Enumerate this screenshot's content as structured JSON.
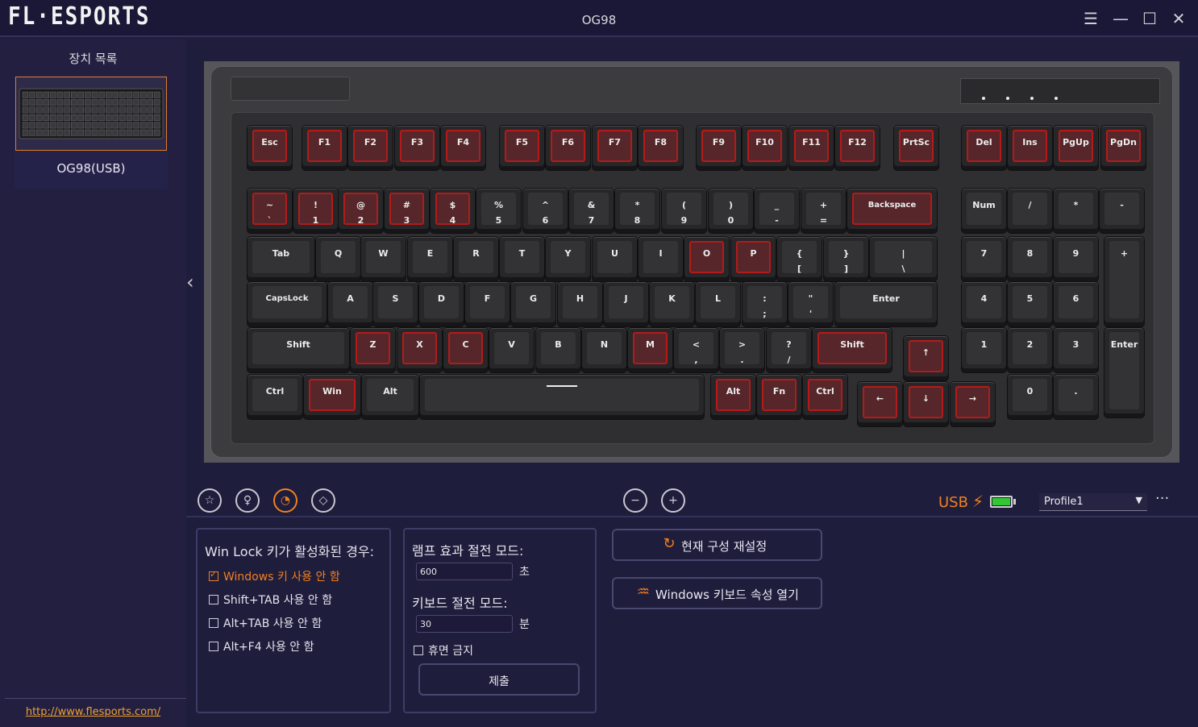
{
  "app": {
    "logo": "FL·ESPORTS",
    "window_title": "OG98"
  },
  "window_controls": {
    "menu_icon": "hamburger-icon",
    "minimize_icon": "minimize-icon",
    "maximize_icon": "maximize-icon",
    "close_icon": "close-icon"
  },
  "sidebar": {
    "title": "장치 목록",
    "device": {
      "name": "OG98(USB)"
    },
    "link": "http://www.flesports.com/"
  },
  "keyboard": {
    "highlight_color": "#b51a1a",
    "keys": [
      {
        "label": "Esc",
        "hl": true
      },
      {
        "label": "F1",
        "hl": true
      },
      {
        "label": "F2",
        "hl": true
      },
      {
        "label": "F3",
        "hl": true
      },
      {
        "label": "F4",
        "hl": true
      },
      {
        "label": "F5",
        "hl": true
      },
      {
        "label": "F6",
        "hl": true
      },
      {
        "label": "F7",
        "hl": true
      },
      {
        "label": "F8",
        "hl": true
      },
      {
        "label": "F9",
        "hl": true
      },
      {
        "label": "F10",
        "hl": true
      },
      {
        "label": "F11",
        "hl": true
      },
      {
        "label": "F12",
        "hl": true
      },
      {
        "label": "PrtSc",
        "hl": true
      },
      {
        "label": "Del",
        "hl": true
      },
      {
        "label": "Ins",
        "hl": true
      },
      {
        "label": "PgUp",
        "hl": true
      },
      {
        "label": "PgDn",
        "hl": true
      },
      {
        "label": "~\n`",
        "hl": true
      },
      {
        "label": "!\n1",
        "hl": true
      },
      {
        "label": "@\n2",
        "hl": true
      },
      {
        "label": "#\n3",
        "hl": true
      },
      {
        "label": "$\n4",
        "hl": true
      },
      {
        "label": "%\n5",
        "hl": false
      },
      {
        "label": "^\n6",
        "hl": false
      },
      {
        "label": "&\n7",
        "hl": false
      },
      {
        "label": "*\n8",
        "hl": false
      },
      {
        "label": "(\n9",
        "hl": false
      },
      {
        "label": ")\n0",
        "hl": false
      },
      {
        "label": "_\n-",
        "hl": false
      },
      {
        "label": "+\n=",
        "hl": false
      },
      {
        "label": "Backspace",
        "hl": true
      },
      {
        "label": "Num",
        "hl": false
      },
      {
        "label": "/",
        "hl": false
      },
      {
        "label": "*",
        "hl": false
      },
      {
        "label": "-",
        "hl": false
      },
      {
        "label": "Tab",
        "hl": false
      },
      {
        "label": "Q",
        "hl": false
      },
      {
        "label": "W",
        "hl": false
      },
      {
        "label": "E",
        "hl": false
      },
      {
        "label": "R",
        "hl": false
      },
      {
        "label": "T",
        "hl": false
      },
      {
        "label": "Y",
        "hl": false
      },
      {
        "label": "U",
        "hl": false
      },
      {
        "label": "I",
        "hl": false
      },
      {
        "label": "O",
        "hl": true
      },
      {
        "label": "P",
        "hl": true
      },
      {
        "label": "{\n[",
        "hl": false
      },
      {
        "label": "}\n]",
        "hl": false
      },
      {
        "label": "|\n\\",
        "hl": false
      },
      {
        "label": "7",
        "hl": false
      },
      {
        "label": "8",
        "hl": false
      },
      {
        "label": "9",
        "hl": false
      },
      {
        "label": "+",
        "hl": false
      },
      {
        "label": "CapsLock",
        "hl": false
      },
      {
        "label": "A",
        "hl": false
      },
      {
        "label": "S",
        "hl": false
      },
      {
        "label": "D",
        "hl": false
      },
      {
        "label": "F",
        "hl": false
      },
      {
        "label": "G",
        "hl": false
      },
      {
        "label": "H",
        "hl": false
      },
      {
        "label": "J",
        "hl": false
      },
      {
        "label": "K",
        "hl": false
      },
      {
        "label": "L",
        "hl": false
      },
      {
        "label": ":\n;",
        "hl": false
      },
      {
        "label": "\"\n'",
        "hl": false
      },
      {
        "label": "Enter",
        "hl": false
      },
      {
        "label": "4",
        "hl": false
      },
      {
        "label": "5",
        "hl": false
      },
      {
        "label": "6",
        "hl": false
      },
      {
        "label": "Shift",
        "hl": false
      },
      {
        "label": "Z",
        "hl": true
      },
      {
        "label": "X",
        "hl": true
      },
      {
        "label": "C",
        "hl": true
      },
      {
        "label": "V",
        "hl": false
      },
      {
        "label": "B",
        "hl": false
      },
      {
        "label": "N",
        "hl": false
      },
      {
        "label": "M",
        "hl": true
      },
      {
        "label": "<\n,",
        "hl": false
      },
      {
        "label": ">\n.",
        "hl": false
      },
      {
        "label": "?\n/",
        "hl": false
      },
      {
        "label": "Shift",
        "hl": true
      },
      {
        "label": "↑",
        "hl": true
      },
      {
        "label": "1",
        "hl": false
      },
      {
        "label": "2",
        "hl": false
      },
      {
        "label": "3",
        "hl": false
      },
      {
        "label": "Enter",
        "hl": false
      },
      {
        "label": "Ctrl",
        "hl": false
      },
      {
        "label": "Win",
        "hl": true
      },
      {
        "label": "Alt",
        "hl": false
      },
      {
        "label": "",
        "hl": false
      },
      {
        "label": "Alt",
        "hl": true
      },
      {
        "label": "Fn",
        "hl": true
      },
      {
        "label": "Ctrl",
        "hl": true
      },
      {
        "label": "←",
        "hl": true
      },
      {
        "label": "↓",
        "hl": true
      },
      {
        "label": "→",
        "hl": true
      },
      {
        "label": "0",
        "hl": false
      },
      {
        "label": ".",
        "hl": false
      }
    ]
  },
  "toolbar": {
    "tabs": [
      {
        "icon": "star-icon",
        "active": false
      },
      {
        "icon": "bulb-icon",
        "active": false
      },
      {
        "icon": "gauge-icon",
        "active": true
      },
      {
        "icon": "macro-icon",
        "active": false
      }
    ],
    "zoom_out_icon": "zoom-out-icon",
    "zoom_in_icon": "zoom-in-icon",
    "connection": "USB",
    "battery_level": 1.0,
    "battery_color": "#32c832",
    "profile": "Profile1",
    "more": "···"
  },
  "winlock": {
    "title": "Win Lock 키가 활성화된 경우:",
    "options": [
      {
        "label": "Windows 키 사용 안 함",
        "checked": true
      },
      {
        "label": "Shift+TAB 사용 안 함",
        "checked": false
      },
      {
        "label": "Alt+TAB 사용 안 함",
        "checked": false
      },
      {
        "label": "Alt+F4 사용 안 함",
        "checked": false
      }
    ]
  },
  "power": {
    "lamp_title": "램프 효과 절전 모드:",
    "lamp_value": "600",
    "lamp_unit": "초",
    "kb_title": "키보드 절전 모드:",
    "kb_value": "30",
    "kb_unit": "분",
    "no_sleep_label": "휴면 금지",
    "no_sleep_checked": false,
    "submit": "제출"
  },
  "actions": {
    "reset_label": "현재 구성 재설정",
    "reset_icon": "refresh-icon",
    "windows_kb_label": "Windows 키보드 속성 열기",
    "windows_kb_icon": "pulse-icon"
  },
  "accent_color": "#f08020"
}
